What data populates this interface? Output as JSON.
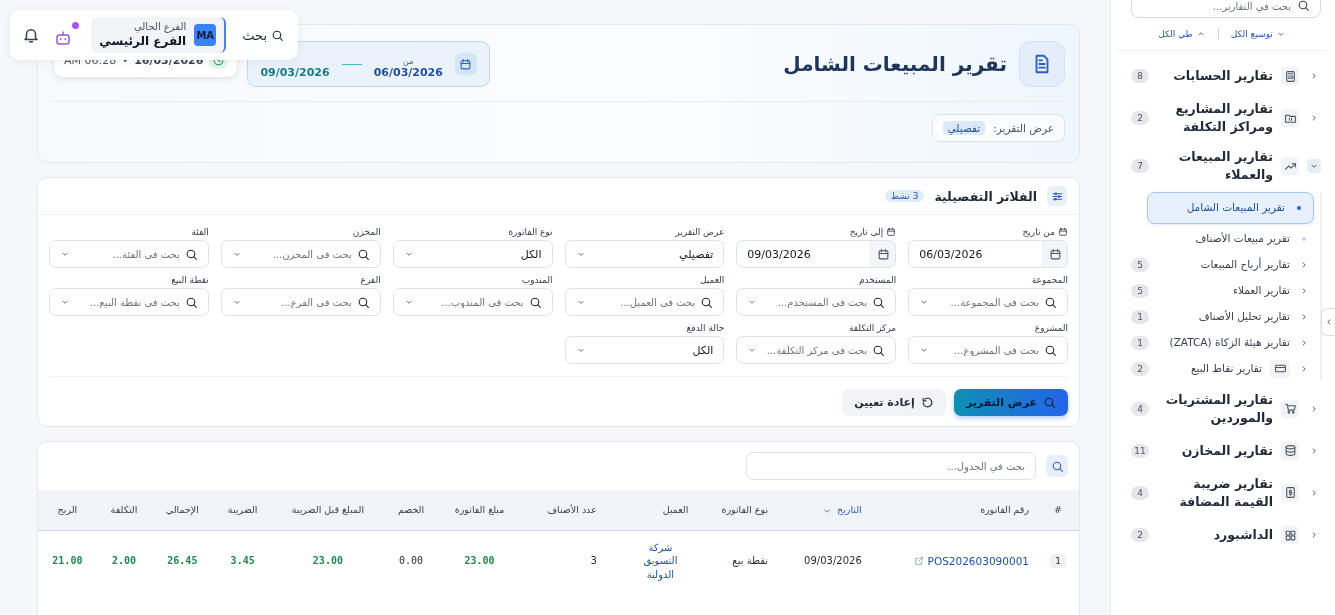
{
  "header_bar": {
    "search_label": "بحث",
    "branch": {
      "avatar": "MA",
      "caption": "الفرع الحالي",
      "name": "الفرع الرئيسي"
    },
    "assistant_notification": true
  },
  "report_header": {
    "title": "تقرير المبيعات الشامل",
    "date_range": {
      "from_label": "من",
      "from": "06/03/2026",
      "to": "09/03/2026"
    },
    "generated": {
      "date": "16/03/2026",
      "separator": "•",
      "time": "AM 06:28"
    },
    "view": {
      "label": "عرض التقرير:",
      "value": "تفصيلي"
    }
  },
  "filters": {
    "title": "الفلاتر التفصيلية",
    "badge": "3 نشط",
    "fields": [
      {
        "label": "من تاريخ",
        "kind": "date",
        "value": "06/03/2026"
      },
      {
        "label": "إلى تاريخ",
        "kind": "date",
        "value": "09/03/2026"
      },
      {
        "label": "عرض التقرير",
        "kind": "select",
        "value": "تفصيلي"
      },
      {
        "label": "نوع الفاتورة",
        "kind": "select",
        "value": "الكل"
      },
      {
        "label": "المخزن",
        "kind": "search",
        "placeholder": "بحث في المخزن..."
      },
      {
        "label": "الفئة",
        "kind": "search",
        "placeholder": "بحث في الفئة..."
      },
      {
        "label": "المجموعة",
        "kind": "search",
        "placeholder": "بحث في المجموعة..."
      },
      {
        "label": "المستخدم",
        "kind": "search",
        "placeholder": "بحث في المستخدم..."
      },
      {
        "label": "العميل",
        "kind": "search",
        "placeholder": "بحث في العميل..."
      },
      {
        "label": "المندوب",
        "kind": "search",
        "placeholder": "بحث في المندوب..."
      },
      {
        "label": "الفرع",
        "kind": "search",
        "placeholder": "بحث في الفرع..."
      },
      {
        "label": "نقطة البيع",
        "kind": "search",
        "placeholder": "بحث في نقطة البيع..."
      },
      {
        "label": "المشروع",
        "kind": "search",
        "placeholder": "بحث في المشروع..."
      },
      {
        "label": "مركز التكلفة",
        "kind": "search",
        "placeholder": "بحث في مركز التكلفة..."
      },
      {
        "label": "حالة الدفع",
        "kind": "select",
        "value": "الكل"
      }
    ],
    "buttons": [
      {
        "label": "عرض التقرير",
        "kind": "primary"
      },
      {
        "label": "إعادة تعيين",
        "kind": "secondary"
      }
    ]
  },
  "table": {
    "search_placeholder": "بحث في الجدول...",
    "columns": [
      {
        "label": "#",
        "kind": "index",
        "sorted": false
      },
      {
        "label": "رقم الفاتورة",
        "kind": "link",
        "sorted": false
      },
      {
        "label": "التاريخ",
        "kind": "text",
        "sorted": true
      },
      {
        "label": "نوع الفاتورة",
        "kind": "text",
        "sorted": false
      },
      {
        "label": "العميل",
        "kind": "customer",
        "sorted": false
      },
      {
        "label": "عدد الأصناف",
        "kind": "text",
        "sorted": false
      },
      {
        "label": "مبلغ الفاتورة",
        "kind": "money",
        "sorted": false
      },
      {
        "label": "الخصم",
        "kind": "number",
        "sorted": false
      },
      {
        "label": "المبلغ قبل الضريبة",
        "kind": "money",
        "sorted": false
      },
      {
        "label": "الضريبة",
        "kind": "money",
        "sorted": false
      },
      {
        "label": "الإجمالي",
        "kind": "money",
        "sorted": false
      },
      {
        "label": "التكلفة",
        "kind": "money",
        "sorted": false
      },
      {
        "label": "الربح",
        "kind": "money",
        "sorted": false
      }
    ],
    "rows": [
      {
        "cells": [
          "1",
          "POS202603090001",
          "09/03/2026",
          "نقطة بيع",
          "شركة التسويق الدولية",
          "3",
          "23.00",
          "0.00",
          "23.00",
          "3.45",
          "26.45",
          "2.00",
          "21.00"
        ]
      }
    ]
  },
  "sidebar": {
    "search_placeholder": "بحث في التقارير...",
    "expand_all": "توسيع الكل",
    "collapse_all": "طي الكل",
    "items": [
      {
        "label": "تقارير الحسابات",
        "count": "8",
        "expanded": false
      },
      {
        "label": "تقارير المشاريع ومراكز التكلفة",
        "count": "2",
        "expanded": false
      },
      {
        "label": "تقارير المبيعات والعملاء",
        "count": "7",
        "expanded": true,
        "children": [
          {
            "label": "تقرير المبيعات الشامل",
            "kind": "report",
            "selected": true
          },
          {
            "label": "تقرير مبيعات الأصناف",
            "kind": "report",
            "selected": false
          },
          {
            "label": "تقارير أرباح المبيعات",
            "kind": "group",
            "count": "5",
            "selected": false
          },
          {
            "label": "تقارير العملاء",
            "kind": "group",
            "count": "5",
            "selected": false
          },
          {
            "label": "تقارير تحليل الأصناف",
            "kind": "group",
            "count": "1",
            "selected": false
          },
          {
            "label": "تقارير هيئة الزكاة (ZATCA)",
            "kind": "group",
            "count": "1",
            "selected": false
          },
          {
            "label": "تقارير نقاط البيع",
            "kind": "icon-group",
            "count": "2",
            "selected": false
          }
        ]
      },
      {
        "label": "تقارير المشتريات والموردين",
        "count": "4",
        "expanded": false
      },
      {
        "label": "تقارير المخازن",
        "count": "11",
        "expanded": false
      },
      {
        "label": "تقارير ضريبة القيمة المضافة",
        "count": "4",
        "expanded": false
      },
      {
        "label": "الداشبورد",
        "count": "2",
        "expanded": false
      }
    ]
  }
}
